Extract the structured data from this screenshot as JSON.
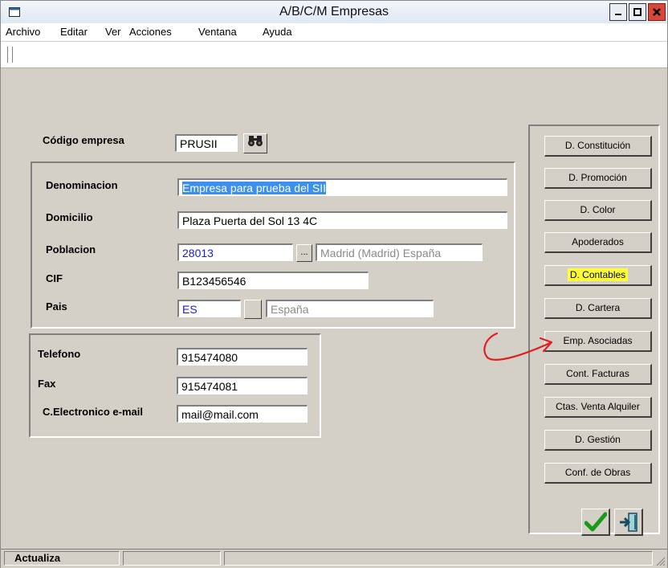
{
  "window": {
    "title": "A/B/C/M Empresas"
  },
  "menu": [
    "Archivo",
    "Editar",
    "Ver",
    "Acciones",
    "Ventana",
    "Ayuda"
  ],
  "form": {
    "codigo": {
      "label": "Código empresa",
      "value": "PRUSII"
    },
    "denominacion": {
      "label": "Denominacion",
      "value": "Empresa para prueba del SII"
    },
    "domicilio": {
      "label": "Domicilio",
      "value": "Plaza Puerta del Sol 13 4C"
    },
    "poblacion": {
      "label": "Poblacion",
      "code": "28013",
      "lookup_label": "...",
      "name": "Madrid (Madrid) España"
    },
    "cif": {
      "label": "CIF",
      "value": "B123456546"
    },
    "pais": {
      "label": "Pais",
      "code": "ES",
      "name": "España"
    },
    "telefono": {
      "label": "Telefono",
      "value": "915474080"
    },
    "fax": {
      "label": "Fax",
      "value": "915474081"
    },
    "email": {
      "label": "C.Electronico e-mail",
      "value": "mail@mail.com"
    }
  },
  "side_buttons": [
    "D. Constitución",
    "D. Promoción",
    "D. Color",
    "Apoderados",
    "D. Contables",
    "D. Cartera",
    "Emp. Asociadas",
    "Cont. Facturas",
    "Ctas. Venta Alquiler",
    "D. Gestión",
    "Conf. de Obras"
  ],
  "status": {
    "pane1": "Actualiza"
  },
  "colors": {
    "highlight": "#ffff38",
    "annotation": "#e02020",
    "selection": "#3a8ff0"
  }
}
